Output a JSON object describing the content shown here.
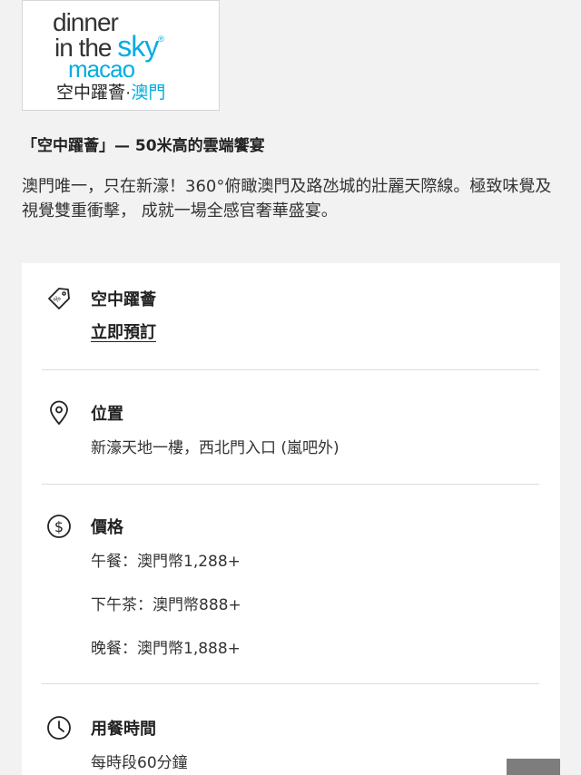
{
  "logo": {
    "line1": "dinner",
    "line2_a": "in the ",
    "line2_sky": "sky",
    "line2_reg": "®",
    "line3": "macao",
    "line4_a": "空中躍薈·",
    "line4_b": "澳門"
  },
  "headline": "「空中躍薈」— 50米高的雲端饗宴",
  "intro": "澳門唯一，只在新濠！360°俯瞰澳門及路氹城的壯麗天際線。極致味覺及視覺雙重衝擊， 成就一場全感官奢華盛宴。",
  "sections": {
    "venue": {
      "icon": "tag-icon",
      "title": "空中躍薈",
      "link": "立即預訂"
    },
    "location": {
      "icon": "location-pin-icon",
      "title": "位置",
      "text": "新濠天地一樓，西北門入口 (嵐吧外)"
    },
    "price": {
      "icon": "dollar-icon",
      "title": "價格",
      "items": [
        "午餐：澳門幣1,288+",
        "下午茶：澳門幣888+",
        "晚餐：澳門幣1,888+"
      ]
    },
    "time": {
      "icon": "clock-icon",
      "title": "用餐時間",
      "text": "每時段60分鐘"
    }
  }
}
